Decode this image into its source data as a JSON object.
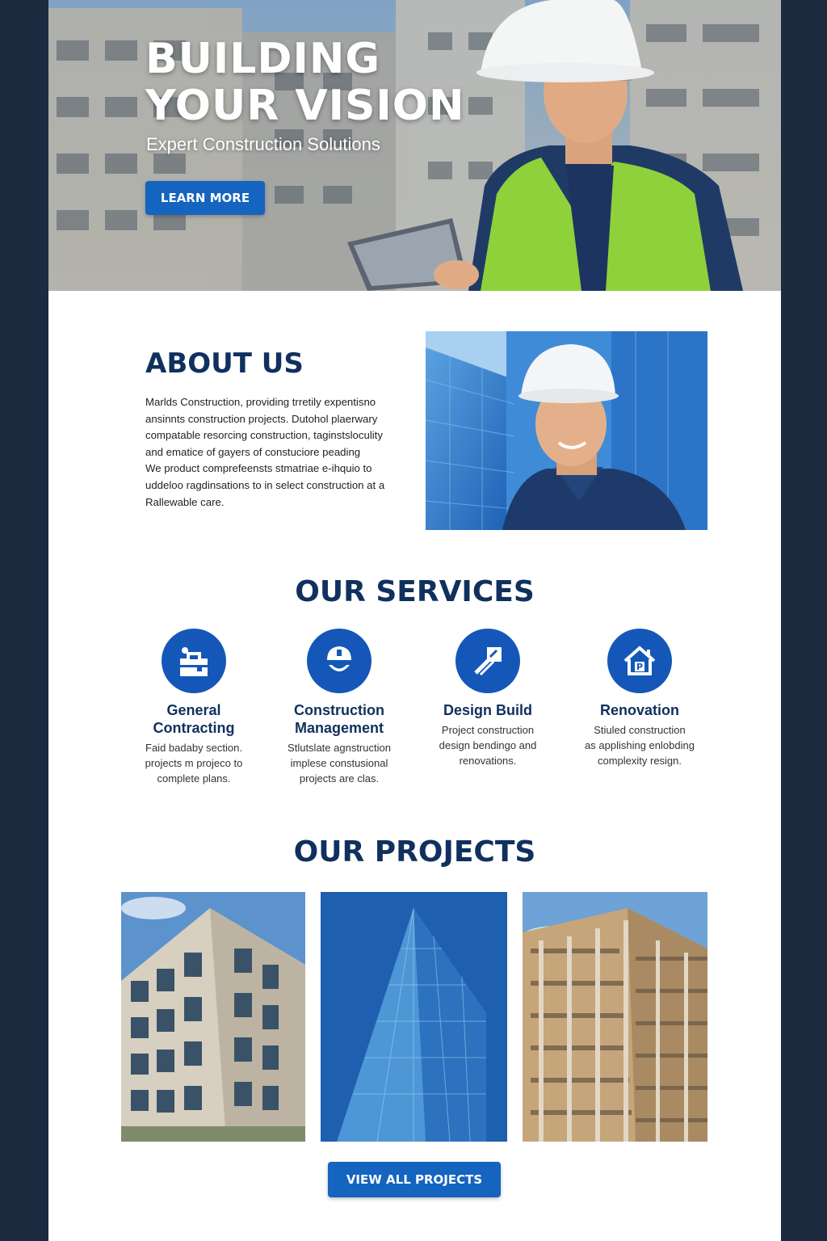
{
  "hero": {
    "title_line1": "BUILDING",
    "title_line2": "YOUR VISION",
    "subtitle": "Expert Construction Solutions",
    "cta_label": "LEARN MORE"
  },
  "about": {
    "title": "ABOUT US",
    "lines": [
      "Marlds Construction, providing trretily expentisno",
      "ansinnts construction projects. Dutohol plaerwary",
      "compatable resorcing construction, taginstsloculity",
      "and ematice of gayers of constuciore peading",
      "We product comprefeensts stmatriae e-ihquio to",
      "uddeloo ragdinsations to in select construction at a",
      "Rallewable care."
    ]
  },
  "services": {
    "title": "OUR SERVICES",
    "items": [
      {
        "icon": "toolbox-icon",
        "name_line1": "General",
        "name_line2": "Contracting",
        "desc": [
          "Faid badaby section.",
          "projects m projeco to",
          "complete plans."
        ]
      },
      {
        "icon": "hard-hat-icon",
        "name_line1": "Construction",
        "name_line2": "Management",
        "desc": [
          "Stlutslate agnstruction",
          "implese constusional",
          "projects are clas."
        ]
      },
      {
        "icon": "design-tools-icon",
        "name_line1": "Design Build",
        "name_line2": "",
        "desc": [
          "Project construction",
          "design bendingo and",
          "renovations."
        ]
      },
      {
        "icon": "house-icon",
        "name_line1": "Renovation",
        "name_line2": "",
        "desc": [
          "Stiuled construction",
          "as applishing enlobding",
          "complexity resign."
        ]
      }
    ]
  },
  "projects": {
    "title": "OUR PROJECTS",
    "items": [
      "modern-office-building-image",
      "glass-skyscraper-image",
      "building-under-construction-image"
    ],
    "cta_label": "VIEW ALL PROJECTS"
  },
  "colors": {
    "page_background": "#1c2b40",
    "primary_blue": "#1464c0",
    "heading_navy": "#10305e"
  }
}
